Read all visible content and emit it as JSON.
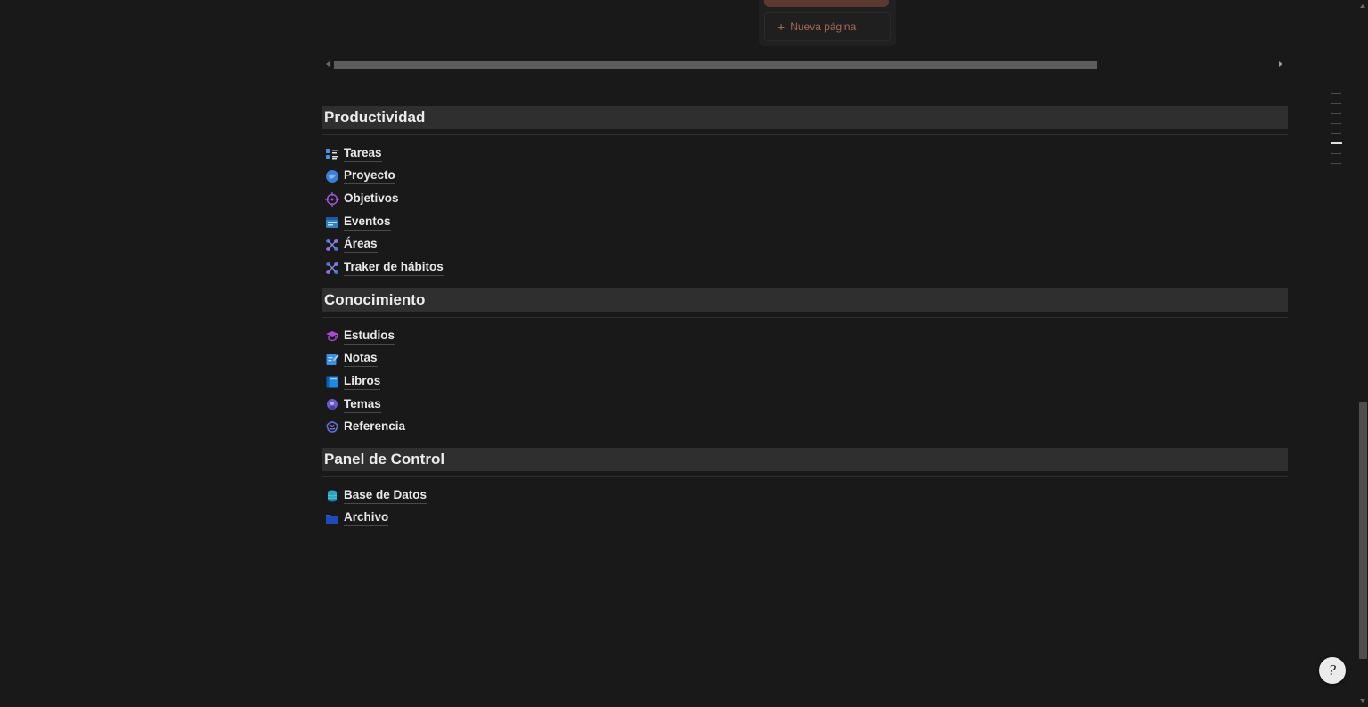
{
  "board": {
    "new_page_label": "Nueva página",
    "plus_glyph": "+"
  },
  "sections": [
    {
      "title": "Productividad",
      "items": [
        {
          "label": "Tareas",
          "icon": "task-list-icon",
          "color": "#4a90e2"
        },
        {
          "label": "Proyecto",
          "icon": "globe-icon",
          "color": "#3b7dd8"
        },
        {
          "label": "Objetivos",
          "icon": "target-icon",
          "color": "#9b59d6"
        },
        {
          "label": "Eventos",
          "icon": "calendar-icon",
          "color": "#2f80c8"
        },
        {
          "label": "Áreas",
          "icon": "network-icon",
          "color": "#4f6fd0"
        },
        {
          "label": "Traker de hábitos",
          "icon": "network-icon",
          "color": "#4f6fd0"
        }
      ]
    },
    {
      "title": "Conocimiento",
      "items": [
        {
          "label": "Estudios",
          "icon": "graduation-icon",
          "color": "#a64bd8"
        },
        {
          "label": "Notas",
          "icon": "notepad-icon",
          "color": "#3c8fe6"
        },
        {
          "label": "Libros",
          "icon": "book-icon",
          "color": "#1e88e5"
        },
        {
          "label": "Temas",
          "icon": "chat-icon",
          "color": "#6a5acd"
        },
        {
          "label": "Referencia",
          "icon": "brain-icon",
          "color": "#5b6fd6"
        }
      ]
    },
    {
      "title": "Panel de Control",
      "items": [
        {
          "label": "Base de Datos",
          "icon": "database-icon",
          "color": "#26a6c9"
        },
        {
          "label": "Archivo",
          "icon": "folder-icon",
          "color": "#2b5fd9"
        }
      ]
    }
  ],
  "help": {
    "glyph": "?",
    "icon": "help-icon"
  }
}
